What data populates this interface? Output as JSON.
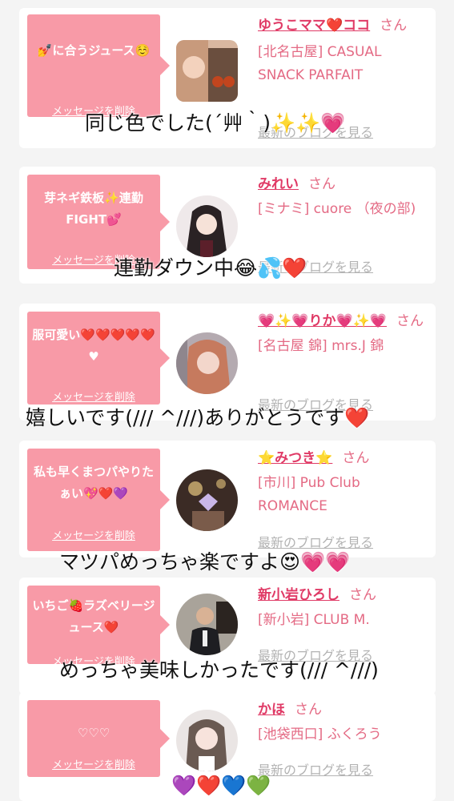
{
  "delete_label": "メッセージを削除",
  "blog_label": "最新のブログを見る",
  "items": [
    {
      "message": "💅に合うジュース☺️",
      "name": "ゆうこママ❤️ココ",
      "san": "さん",
      "shop": "[北名古屋] CASUAL SNACK PARFAIT",
      "overlay": "同じ色でした(´艸｀)✨✨💗"
    },
    {
      "message": "芽ネギ鉄板✨連勤FIGHT💕",
      "name": "みれい",
      "san": "さん",
      "shop": "[ミナミ] cuore （夜の部)",
      "overlay": "連勤ダウン中😂💦❤️"
    },
    {
      "message": "服可愛い❤️❤️❤️❤️❤️♥",
      "name": "💗✨💗りか💗✨💗",
      "san": "さん",
      "shop": "[名古屋 錦] mrs.J 錦",
      "overlay": "嬉しいです(/// ^///)ありがとうです❤️"
    },
    {
      "message": "私も早くまつパやりたぁい💖❤️💜",
      "name": "⭐みつき⭐",
      "san": "さん",
      "shop": "[市川] Pub Club ROMANCE",
      "overlay": "マツパめっちゃ楽ですよ😍💗💗"
    },
    {
      "message": "いちご🍓ラズベリージュース❤️",
      "name": "新小岩ひろし",
      "san": "さん",
      "shop": "[新小岩] CLUB M.",
      "overlay": "めっちゃ美味しかったです(/// ^///)"
    },
    {
      "message": "♡♡♡",
      "name": "かほ",
      "san": "さん",
      "shop": "[池袋西口] ふくろう",
      "overlay": "💜❤️💙💚"
    }
  ],
  "colors": {
    "bubble": "#f89aa7",
    "name": "#e03a66",
    "shop": "#e46a84",
    "blog": "#b3b3b3",
    "background": "#f4f4f4"
  }
}
